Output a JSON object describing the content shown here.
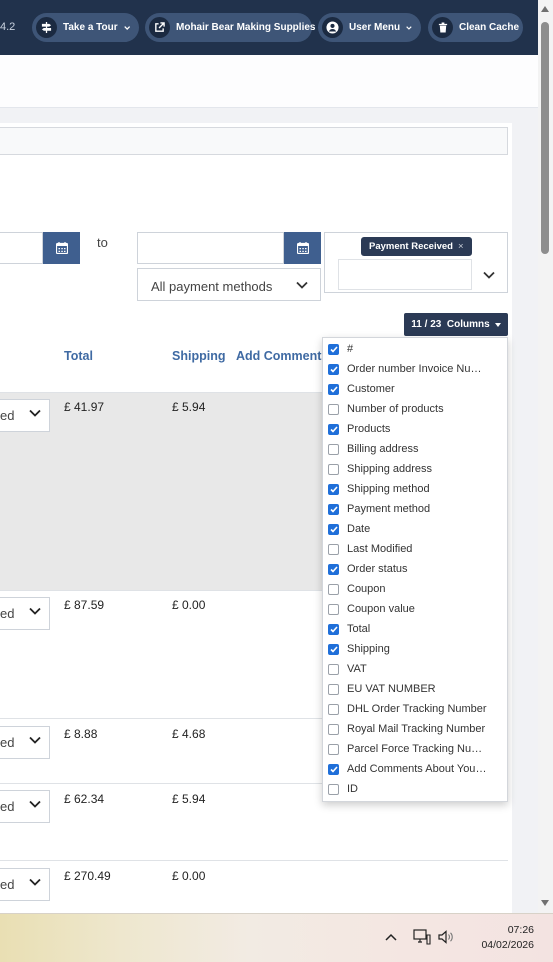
{
  "header": {
    "version": "4.2",
    "buttons": {
      "tour": "Take a Tour",
      "store": "Mohair Bear Making Supplies",
      "user": "User Menu",
      "cache": "Clean Cache"
    }
  },
  "filters": {
    "to_label": "to",
    "payment_methods": "All payment methods",
    "status_tag": "Payment Received",
    "status_tag_remove": "×"
  },
  "columns_button": {
    "shown": "11",
    "separator": "/",
    "total": "23",
    "label": "Columns"
  },
  "table": {
    "headers": {
      "total": "Total",
      "shipping": "Shipping",
      "add_comments": "Add Comments"
    },
    "rows": [
      {
        "status": "ed",
        "total": "£ 41.97",
        "shipping": "£ 5.94"
      },
      {
        "status": "ed",
        "total": "£ 87.59",
        "shipping": "£ 0.00"
      },
      {
        "status": "ed",
        "total": "£ 8.88",
        "shipping": "£ 4.68"
      },
      {
        "status": "ed",
        "total": "£ 62.34",
        "shipping": "£ 5.94"
      },
      {
        "status": "ed",
        "total": "£ 270.49",
        "shipping": "£ 0.00"
      }
    ]
  },
  "column_options": [
    {
      "label": "#",
      "checked": true
    },
    {
      "label": "Order number Invoice Number",
      "checked": true
    },
    {
      "label": "Customer",
      "checked": true
    },
    {
      "label": "Number of products",
      "checked": false
    },
    {
      "label": "Products",
      "checked": true
    },
    {
      "label": "Billing address",
      "checked": false
    },
    {
      "label": "Shipping address",
      "checked": false
    },
    {
      "label": "Shipping method",
      "checked": true
    },
    {
      "label": "Payment method",
      "checked": true
    },
    {
      "label": "Date",
      "checked": true
    },
    {
      "label": "Last Modified",
      "checked": false
    },
    {
      "label": "Order status",
      "checked": true
    },
    {
      "label": "Coupon",
      "checked": false
    },
    {
      "label": "Coupon value",
      "checked": false
    },
    {
      "label": "Total",
      "checked": true
    },
    {
      "label": "Shipping",
      "checked": true
    },
    {
      "label": "VAT",
      "checked": false
    },
    {
      "label": "EU VAT NUMBER",
      "checked": false
    },
    {
      "label": "DHL Order Tracking Number",
      "checked": false
    },
    {
      "label": "Royal Mail Tracking Number",
      "checked": false
    },
    {
      "label": "Parcel Force Tracking Number",
      "checked": false
    },
    {
      "label": "Add Comments About Your Order",
      "checked": true
    },
    {
      "label": "ID",
      "checked": false
    }
  ],
  "taskbar": {
    "time": "07:26",
    "date": "04/02/2026"
  },
  "colors": {
    "topbar": "#21324c",
    "pill": "#3e5577",
    "accent": "#3f6aa3",
    "checkbox": "#1f6fd9",
    "tag": "#2b3a55"
  },
  "icons": [
    "signpost-icon",
    "external-link-icon",
    "user-circle-icon",
    "trash-icon",
    "calendar-icon",
    "chevron-down-icon",
    "chevron-up-icon",
    "monitor-network-icon",
    "speaker-icon"
  ]
}
